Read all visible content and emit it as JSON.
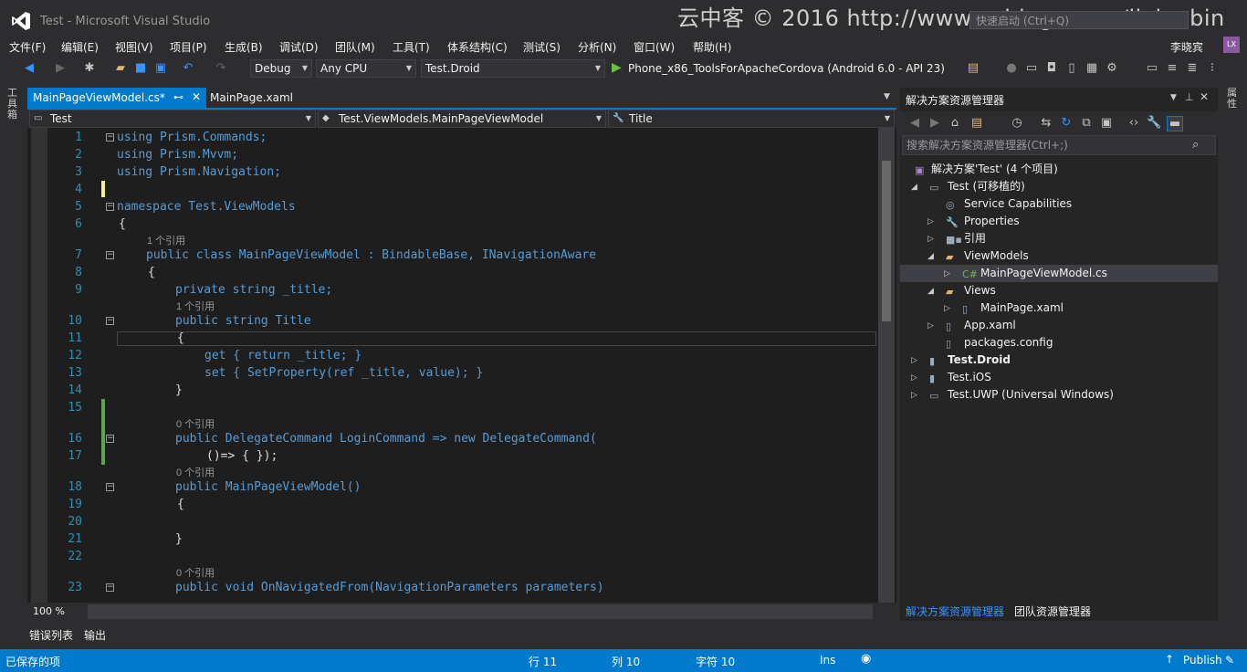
{
  "window": {
    "title": "Test - Microsoft Visual Studio",
    "watermark": "云中客 © 2016 http://www.cnblogs.com/lixiaobin",
    "quick_launch_placeholder": "快速启动 (Ctrl+Q)",
    "user_name": "李晓宾",
    "user_initials": "LX"
  },
  "menu": [
    "文件(F)",
    "编辑(E)",
    "视图(V)",
    "项目(P)",
    "生成(B)",
    "调试(D)",
    "团队(M)",
    "工具(T)",
    "体系结构(C)",
    "测试(S)",
    "分析(N)",
    "窗口(W)",
    "帮助(H)"
  ],
  "toolbar": {
    "config": "Debug",
    "platform": "Any CPU",
    "startup_project": "Test.Droid",
    "run_target": "Phone_x86_ToolsForApacheCordova (Android 6.0 - API 23)"
  },
  "side_tabs": {
    "toolbox": "工具箱",
    "properties": "属性"
  },
  "doc_tabs": {
    "active": "MainPageViewModel.cs*",
    "active_pin": "⊷",
    "active_close": "✕",
    "second": "MainPage.xaml"
  },
  "navbar": {
    "project": "Test",
    "type": "Test.ViewModels.MainPageViewModel",
    "member": "Title"
  },
  "editor": {
    "zoom": "100 %",
    "line_numbers": [
      "1",
      "2",
      "3",
      "4",
      "5",
      "6",
      "7",
      "8",
      "9",
      "10",
      "11",
      "12",
      "13",
      "14",
      "15",
      "16",
      "17",
      "18",
      "19",
      "20",
      "21",
      "22",
      "23"
    ],
    "ref_zero": "0 个引用",
    "ref_one": "1 个引用",
    "code": {
      "l1": "using Prism.Commands;",
      "l2": "using Prism.Mvvm;",
      "l3": "using Prism.Navigation;",
      "l5": "namespace Test.ViewModels",
      "l6": "{",
      "l7": "public class MainPageViewModel : BindableBase, INavigationAware",
      "l8": "{",
      "l9": "private string _title;",
      "l10": "public string Title",
      "l11": "{",
      "l12": "get { return _title; }",
      "l13": "set { SetProperty(ref _title, value); }",
      "l14": "}",
      "l16": "public DelegateCommand LoginCommand => new DelegateCommand(",
      "l17": "()=> { });",
      "l18": "public MainPageViewModel()",
      "l19": "{",
      "l21": "}",
      "l23": "public void OnNavigatedFrom(NavigationParameters parameters)"
    }
  },
  "bottom_tabs": [
    "错误列表",
    "输出"
  ],
  "solution_explorer": {
    "title": "解决方案资源管理器",
    "search_placeholder": "搜索解决方案资源管理器(Ctrl+;)",
    "items": [
      {
        "label": "解决方案'Test' (4 个项目)",
        "bold": false
      },
      {
        "label": "Test (可移植的)",
        "bold": false
      },
      {
        "label": "Service Capabilities",
        "bold": false
      },
      {
        "label": "Properties",
        "bold": false
      },
      {
        "label": "引用",
        "bold": false
      },
      {
        "label": "ViewModels",
        "bold": false
      },
      {
        "label": "MainPageViewModel.cs",
        "bold": false
      },
      {
        "label": "Views",
        "bold": false
      },
      {
        "label": "MainPage.xaml",
        "bold": false
      },
      {
        "label": "App.xaml",
        "bold": false
      },
      {
        "label": "packages.config",
        "bold": false
      },
      {
        "label": "Test.Droid",
        "bold": true
      },
      {
        "label": "Test.iOS",
        "bold": false
      },
      {
        "label": "Test.UWP (Universal Windows)",
        "bold": false
      }
    ],
    "bottom_tabs": [
      "解决方案资源管理器",
      "团队资源管理器"
    ]
  },
  "statusbar": {
    "message": "已保存的项",
    "row": "行 11",
    "col": "列 10",
    "char": "字符 10",
    "mode": "Ins",
    "publish": "Publish"
  },
  "colors": {
    "accent": "#007acc",
    "keyword": "#569cd6",
    "type": "#4ec9b0",
    "line_number": "#2b91af"
  }
}
